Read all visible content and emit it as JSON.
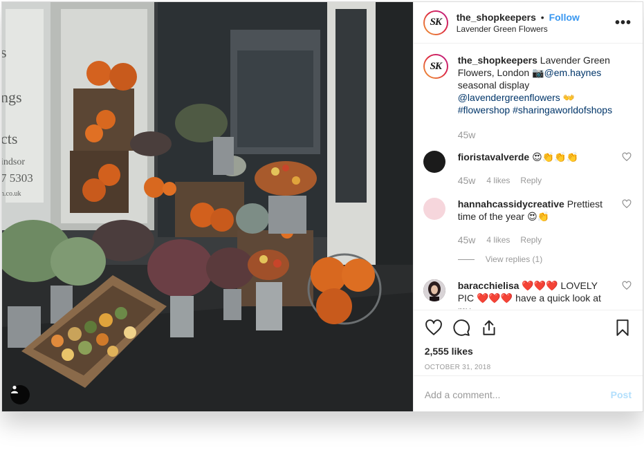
{
  "post": {
    "username": "the_shopkeepers",
    "separator": "•",
    "follow_label": "Follow",
    "location": "Lavender Green Flowers",
    "avatar_initials": "SK",
    "more_icon": "more-horizontal-icon"
  },
  "caption": {
    "username": "the_shopkeepers",
    "text_1": "Lavender Green Flowers, London",
    "camera_emoji": "📷",
    "mention_1": "@em.haynes",
    "text_2": "seasonal display",
    "mention_2": "@lavendergreenflowers",
    "emoji_2": "👐",
    "hashtag_1": "#flowershop",
    "hashtag_2": "#sharingaworldofshops",
    "time": "45w"
  },
  "comments": [
    {
      "username": "fioristavalverde",
      "text": "😍👏👏👏",
      "time": "45w",
      "likes": "4 likes",
      "reply_label": "Reply",
      "avatar_color": "#1b1b1b"
    },
    {
      "username": "hannahcassidycreative",
      "text": "Prettiest time of the year 😍👏",
      "time": "45w",
      "likes": "4 likes",
      "reply_label": "Reply",
      "view_replies": "View replies (1)",
      "avatar_color": "#f6d6dc"
    },
    {
      "username": "baracchielisa",
      "text": "❤️❤️❤️ LOVELY PIC ❤️❤️❤️ have a quick look at my",
      "avatar_color": "#3a2a2e"
    }
  ],
  "actions": {
    "like_icon": "heart-icon",
    "comment_icon": "comment-icon",
    "share_icon": "share-icon",
    "save_icon": "bookmark-icon",
    "likes": "2,555 likes",
    "date": "OCTOBER 31, 2018"
  },
  "add_comment": {
    "placeholder": "Add a comment...",
    "post_label": "Post"
  },
  "photo": {
    "alt": "Shop front with pumpkins and flowers in crates",
    "tag_icon": "user-tag-icon"
  },
  "colors": {
    "link": "#003569",
    "follow": "#3897f0",
    "post_disabled": "#b2dffc",
    "muted": "#999999"
  }
}
